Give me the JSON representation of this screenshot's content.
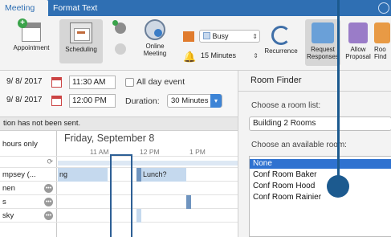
{
  "tabs": [
    "Meeting",
    "Format Text"
  ],
  "ribbon": {
    "appointment": "Appointment",
    "scheduling": "Scheduling",
    "online_meeting": "Online\nMeeting",
    "show_as": "Busy",
    "reminder": "15 Minutes",
    "recurrence": "Recurrence",
    "request_responses": "Request\nResponses",
    "allow_proposal": "Allow\nProposal",
    "room_finder": "Roo\nFind"
  },
  "datetime": {
    "start_date": "9/ 8/ 2017",
    "start_time": "11:30 AM",
    "end_date": "9/ 8/ 2017",
    "end_time": "12:00 PM",
    "all_day_label": "All day event",
    "duration_label": "Duration:",
    "duration_value": "30 Minutes"
  },
  "notice": "tion has not been sent.",
  "schedule": {
    "filter_label": "hours only",
    "date_heading": "Friday, September 8",
    "times": [
      "11 AM",
      "12 PM",
      "1 PM"
    ],
    "attendees": [
      "mpsey (...",
      "nen",
      "s",
      "sky"
    ],
    "lunch_label": "Lunch?",
    "busy_label": "ng"
  },
  "room_finder": {
    "title": "Room Finder",
    "room_list_label": "Choose a room list:",
    "room_list_value": "Building 2 Rooms",
    "available_label": "Choose an available room:",
    "rooms": [
      "None",
      "Conf Room Baker",
      "Conf Room Hood",
      "Conf Room Rainier"
    ],
    "selected_index": 0
  },
  "colors": {
    "accent": "#2f6fb3",
    "selection": "#2f72d0",
    "pointer": "#1c5a8f"
  }
}
